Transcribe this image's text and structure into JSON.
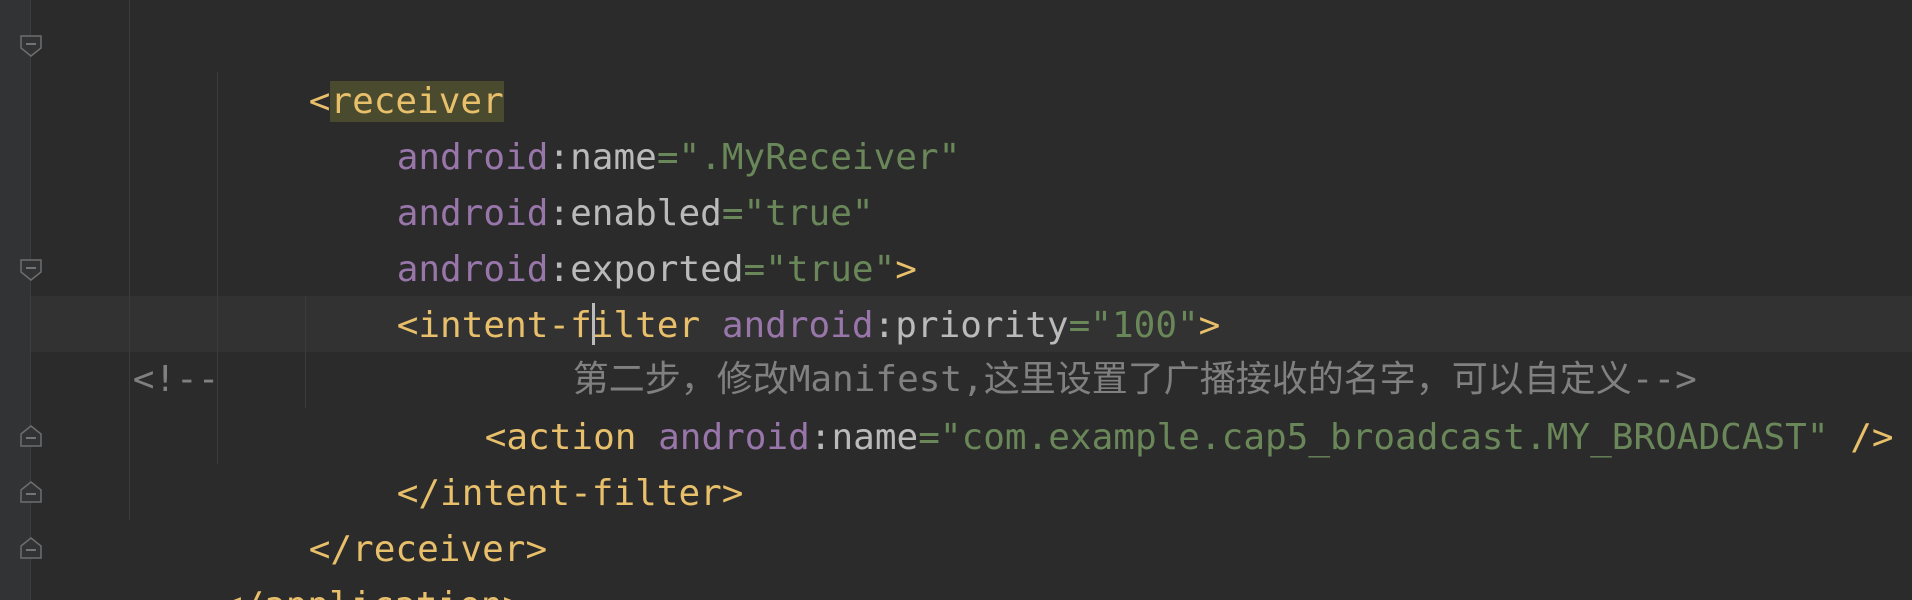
{
  "editor": {
    "lines": {
      "l1": {
        "lt": "<",
        "tag": "receiver"
      },
      "l2": {
        "ns": "android",
        "colon": ":",
        "attr": "name",
        "eq": "=",
        "val": "\".MyReceiver\""
      },
      "l3": {
        "ns": "android",
        "colon": ":",
        "attr": "enabled",
        "eq": "=",
        "val": "\"true\""
      },
      "l4": {
        "ns": "android",
        "colon": ":",
        "attr": "exported",
        "eq": "=",
        "val": "\"true\"",
        "close": ">"
      },
      "l5": {
        "open": "<intent-filter ",
        "ns": "android",
        "colon": ":",
        "attr": "priority",
        "eq": "=",
        "val": "\"100\"",
        "close": ">"
      },
      "l6": {
        "start": "<!--",
        "text": "第二步，修改Manifest,这里设置了广播接收的名字，可以自定义-->"
      },
      "l7": {
        "open": "<action ",
        "ns": "android",
        "colon": ":",
        "attr": "name",
        "eq": "=",
        "val": "\"com.example.cap5_broadcast.MY_BROADCAST\"",
        "close": " />"
      },
      "l8": {
        "tag": "</intent-filter>"
      },
      "l9": {
        "tag": "</receiver>"
      },
      "l10": {
        "tag": "</application>"
      }
    }
  }
}
